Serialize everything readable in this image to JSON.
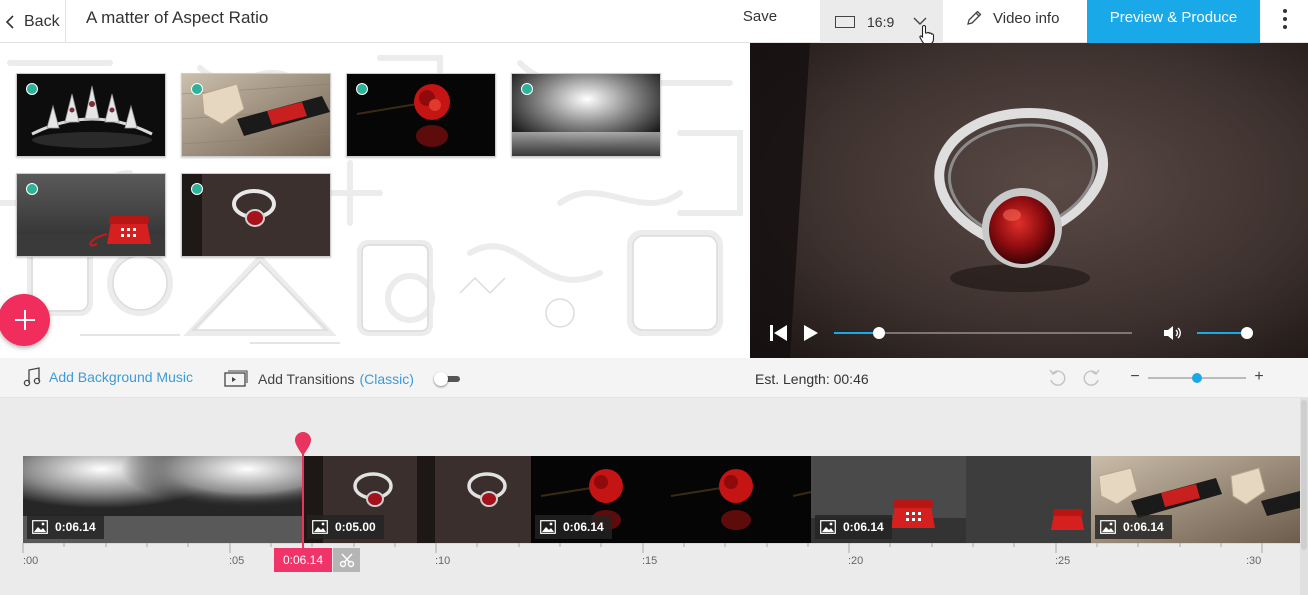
{
  "header": {
    "back_label": "Back",
    "project_title": "A matter of Aspect Ratio",
    "save_label": "Save",
    "aspect_ratio": "16:9",
    "video_info_label": "Video info",
    "produce_label": "Preview & Produce"
  },
  "library": {
    "items": [
      {
        "subject": "tiara"
      },
      {
        "subject": "wine-bottle"
      },
      {
        "subject": "red-rose"
      },
      {
        "subject": "spotlight-backdrop"
      },
      {
        "subject": "red-telephone"
      },
      {
        "subject": "ring"
      }
    ]
  },
  "player": {
    "progress": 0.15,
    "volume": 1.0
  },
  "toolbar": {
    "add_music_label": "Add Background Music",
    "add_transitions_label": "Add Transitions",
    "transitions_mode": "(Classic)",
    "est_length": "Est. Length: 00:46",
    "zoom_level": 0.5
  },
  "timeline": {
    "clips": [
      {
        "subject": "spotlight-backdrop",
        "duration": "0:06.14"
      },
      {
        "subject": "ring",
        "duration": "0:05.00"
      },
      {
        "subject": "red-rose",
        "duration": "0:06.14"
      },
      {
        "subject": "red-telephone",
        "duration": "0:06.14"
      },
      {
        "subject": "wine-bottle",
        "duration": "0:06.14"
      }
    ],
    "ruler_labels": [
      ":00",
      ":05",
      ":10",
      ":15",
      ":20",
      ":25",
      ":30"
    ],
    "playhead_time": "0:06.14"
  },
  "colors": {
    "accent_blue": "#19a8e8",
    "produce_blue": "#19a8e8",
    "playhead_pink": "#e8345e",
    "fab_pink": "#f02d5c",
    "dot_teal": "#2fb29a"
  }
}
